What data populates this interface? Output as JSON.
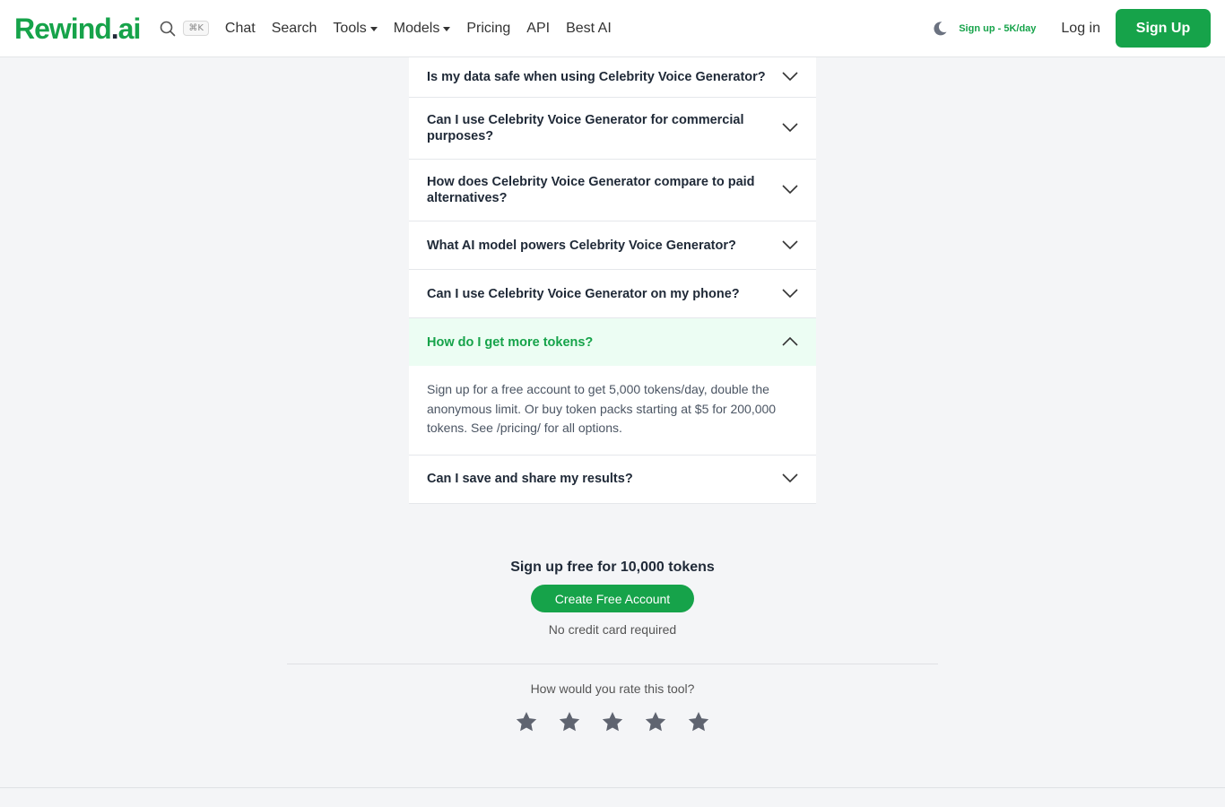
{
  "header": {
    "logo_main": "Rewind",
    "logo_dot": ".",
    "logo_ai": "ai",
    "search_shortcut": "⌘K",
    "nav": [
      {
        "label": "Chat",
        "dropdown": false
      },
      {
        "label": "Search",
        "dropdown": false
      },
      {
        "label": "Tools",
        "dropdown": true
      },
      {
        "label": "Models",
        "dropdown": true
      },
      {
        "label": "Pricing",
        "dropdown": false
      },
      {
        "label": "API",
        "dropdown": false
      },
      {
        "label": "Best AI",
        "dropdown": false
      }
    ],
    "signup_promo": "Sign up - 5K/day",
    "login": "Log in",
    "signup": "Sign Up"
  },
  "faq": [
    {
      "q": "Is my data safe when using Celebrity Voice Generator?",
      "open": false
    },
    {
      "q": "Can I use Celebrity Voice Generator for commercial purposes?",
      "open": false
    },
    {
      "q": "How does Celebrity Voice Generator compare to paid alternatives?",
      "open": false
    },
    {
      "q": "What AI model powers Celebrity Voice Generator?",
      "open": false
    },
    {
      "q": "Can I use Celebrity Voice Generator on my phone?",
      "open": false
    },
    {
      "q": "How do I get more tokens?",
      "open": true,
      "a": "Sign up for a free account to get 5,000 tokens/day, double the anonymous limit. Or buy token packs starting at $5 for 200,000 tokens. See /pricing/ for all options."
    },
    {
      "q": "Can I save and share my results?",
      "open": false
    }
  ],
  "cta": {
    "title": "Sign up free for 10,000 tokens",
    "button": "Create Free Account",
    "note": "No credit card required"
  },
  "rating": {
    "question": "How would you rate this tool?",
    "stars": 5
  },
  "colors": {
    "brand": "#16a34a",
    "open_bg": "#ecfdf3"
  }
}
